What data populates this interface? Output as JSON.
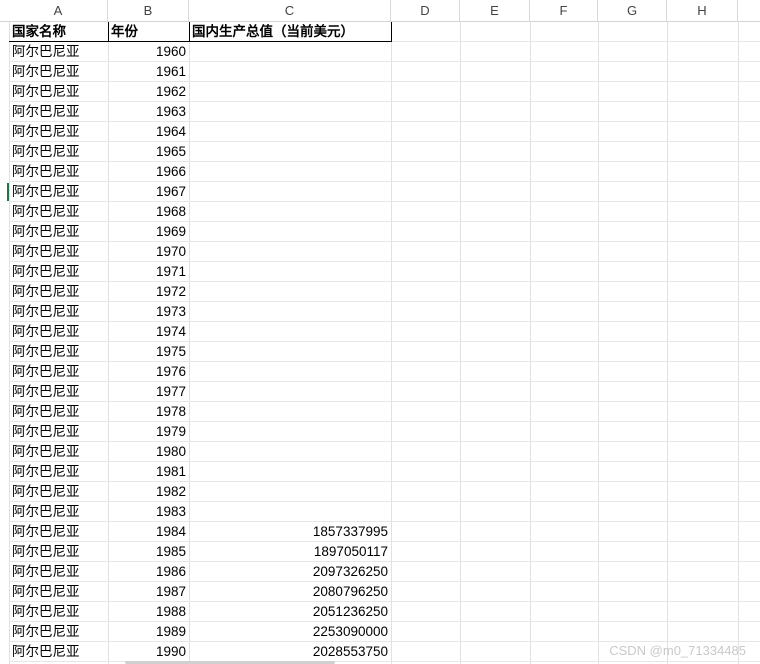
{
  "column_headers": [
    "A",
    "B",
    "C",
    "D",
    "E",
    "F",
    "G",
    "H"
  ],
  "header_row": {
    "country": "国家名称",
    "year": "年份",
    "gdp": "国内生产总值（当前美元）"
  },
  "rows": [
    {
      "country": "阿尔巴尼亚",
      "year": "1960",
      "gdp": ""
    },
    {
      "country": "阿尔巴尼亚",
      "year": "1961",
      "gdp": ""
    },
    {
      "country": "阿尔巴尼亚",
      "year": "1962",
      "gdp": ""
    },
    {
      "country": "阿尔巴尼亚",
      "year": "1963",
      "gdp": ""
    },
    {
      "country": "阿尔巴尼亚",
      "year": "1964",
      "gdp": ""
    },
    {
      "country": "阿尔巴尼亚",
      "year": "1965",
      "gdp": ""
    },
    {
      "country": "阿尔巴尼亚",
      "year": "1966",
      "gdp": ""
    },
    {
      "country": "阿尔巴尼亚",
      "year": "1967",
      "gdp": ""
    },
    {
      "country": "阿尔巴尼亚",
      "year": "1968",
      "gdp": ""
    },
    {
      "country": "阿尔巴尼亚",
      "year": "1969",
      "gdp": ""
    },
    {
      "country": "阿尔巴尼亚",
      "year": "1970",
      "gdp": ""
    },
    {
      "country": "阿尔巴尼亚",
      "year": "1971",
      "gdp": ""
    },
    {
      "country": "阿尔巴尼亚",
      "year": "1972",
      "gdp": ""
    },
    {
      "country": "阿尔巴尼亚",
      "year": "1973",
      "gdp": ""
    },
    {
      "country": "阿尔巴尼亚",
      "year": "1974",
      "gdp": ""
    },
    {
      "country": "阿尔巴尼亚",
      "year": "1975",
      "gdp": ""
    },
    {
      "country": "阿尔巴尼亚",
      "year": "1976",
      "gdp": ""
    },
    {
      "country": "阿尔巴尼亚",
      "year": "1977",
      "gdp": ""
    },
    {
      "country": "阿尔巴尼亚",
      "year": "1978",
      "gdp": ""
    },
    {
      "country": "阿尔巴尼亚",
      "year": "1979",
      "gdp": ""
    },
    {
      "country": "阿尔巴尼亚",
      "year": "1980",
      "gdp": ""
    },
    {
      "country": "阿尔巴尼亚",
      "year": "1981",
      "gdp": ""
    },
    {
      "country": "阿尔巴尼亚",
      "year": "1982",
      "gdp": ""
    },
    {
      "country": "阿尔巴尼亚",
      "year": "1983",
      "gdp": ""
    },
    {
      "country": "阿尔巴尼亚",
      "year": "1984",
      "gdp": "1857337995"
    },
    {
      "country": "阿尔巴尼亚",
      "year": "1985",
      "gdp": "1897050117"
    },
    {
      "country": "阿尔巴尼亚",
      "year": "1986",
      "gdp": "2097326250"
    },
    {
      "country": "阿尔巴尼亚",
      "year": "1987",
      "gdp": "2080796250"
    },
    {
      "country": "阿尔巴尼亚",
      "year": "1988",
      "gdp": "2051236250"
    },
    {
      "country": "阿尔巴尼亚",
      "year": "1989",
      "gdp": "2253090000"
    },
    {
      "country": "阿尔巴尼亚",
      "year": "1990",
      "gdp": "2028553750"
    }
  ],
  "watermark": "CSDN @m0_71334485",
  "colors": {
    "accent": "#217346",
    "gridline": "#e1e1e1"
  }
}
